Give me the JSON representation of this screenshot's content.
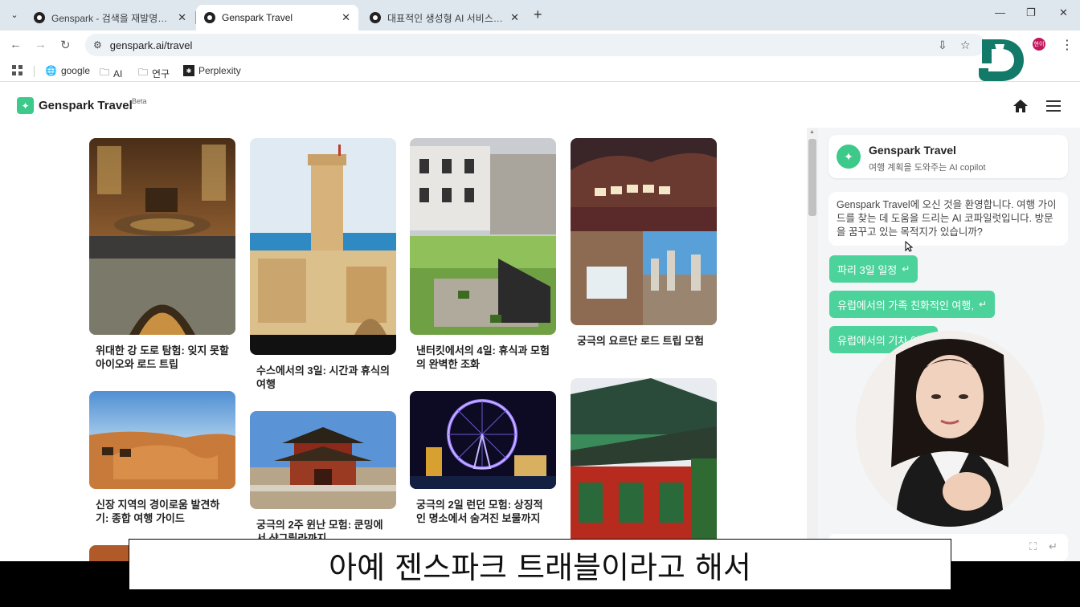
{
  "browser": {
    "tabs": [
      {
        "title": "Genspark - 검색을 재발명하다",
        "close": "✕"
      },
      {
        "title": "Genspark Travel",
        "close": "✕"
      },
      {
        "title": "대표적인 생성형 AI 서비스 비교",
        "close": "✕"
      }
    ],
    "new_tab": "+",
    "window": {
      "minimize": "—",
      "restore": "❐",
      "close": "✕"
    },
    "url": "genspark.ai/travel",
    "profile": "현이",
    "bookmarks": [
      {
        "label": "google",
        "icon": "globe-icon"
      },
      {
        "label": "AI",
        "icon": "folder-icon"
      },
      {
        "label": "연구",
        "icon": "folder-icon"
      },
      {
        "label": "Perplexity",
        "icon": "perplexity-icon"
      }
    ]
  },
  "app": {
    "brand": "Genspark Travel",
    "beta": "Beta"
  },
  "cards": [
    {
      "caption": "위대한 강 도로 탐험: 잊지 못할 아이오와 로드 트립"
    },
    {
      "caption": "수스에서의 3일: 시간과 휴식의 여행"
    },
    {
      "caption": "낸터킷에서의 4일: 휴식과 모험의 완벽한 조화"
    },
    {
      "caption": "궁극의 요르단 로드 트립 모험"
    },
    {
      "caption": "신장 지역의 경이로움 발견하기: 종합 여행 가이드"
    },
    {
      "caption": "궁극의 2주 윈난 모험: 쿤밍에서 샹그릴라까지"
    },
    {
      "caption": "궁극의 2일 런던 모험: 상징적인 명소에서 숨겨진 보물까지"
    }
  ],
  "chat": {
    "title": "Genspark Travel",
    "subtitle": "여행 계획을 도와주는 AI copilot",
    "welcome": "Genspark Travel에 오신 것을 환영합니다. 여행 가이드를 찾는 데 도움을 드리는 AI 코파일럿입니다. 방문을 꿈꾸고 있는 목적지가 있습니까?",
    "suggestions": [
      "파리 3일 일정",
      "유럽에서의 가족 친화적인 여행,",
      "유럽에서의 기차 여행"
    ],
    "return_glyph": "↵"
  },
  "subtitle_text": "아예 젠스파크 트래블이라고 해서"
}
